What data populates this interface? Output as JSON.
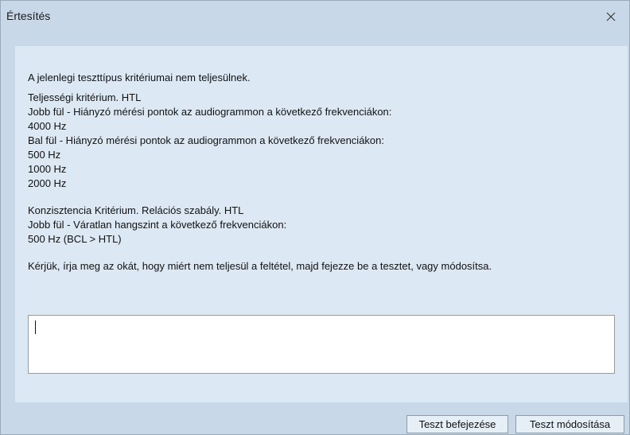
{
  "window": {
    "title": "Értesítés"
  },
  "message": {
    "intro": "A jelenlegi teszttípus kritériumai nem teljesülnek.",
    "completeness": {
      "header": "Teljességi kritérium. HTL",
      "right_ear": "Jobb fül - Hiányzó mérési pontok az audiogrammon a következő frekvenciákon:",
      "right_freqs": [
        "4000 Hz"
      ],
      "left_ear": "Bal fül - Hiányzó mérési pontok az audiogrammon a következő frekvenciákon:",
      "left_freqs": [
        "500 Hz",
        "1000 Hz",
        "2000 Hz"
      ]
    },
    "consistency": {
      "header": "Konzisztencia Kritérium. Relációs szabály. HTL",
      "right_ear": "Jobb fül - Váratlan hangszint a következő frekvenciákon:",
      "right_freqs": [
        "500 Hz (BCL > HTL)"
      ]
    },
    "prompt": "Kérjük, írja meg az okát, hogy miért nem teljesül a feltétel, majd fejezze be a tesztet, vagy módosítsa."
  },
  "reason_input": {
    "value": ""
  },
  "buttons": {
    "finish_label": "Teszt befejezése",
    "modify_label": "Teszt módosítása"
  },
  "icons": {
    "close": "close-icon"
  },
  "colors": {
    "frame": "#c8d8e8",
    "panel": "#dce9f5",
    "button": "#e6eef6"
  }
}
